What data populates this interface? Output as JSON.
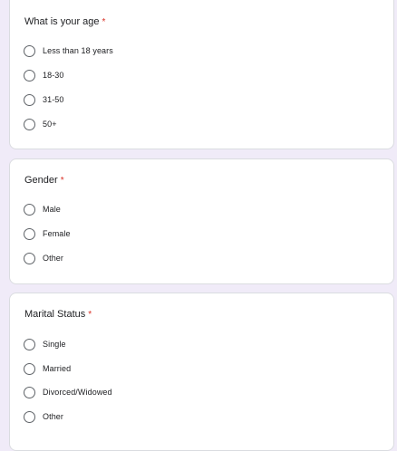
{
  "questions": [
    {
      "title": "What is your age",
      "required_mark": "*",
      "options": [
        "Less than 18 years",
        "18-30",
        "31-50",
        "50+"
      ]
    },
    {
      "title": "Gender",
      "required_mark": "*",
      "options": [
        "Male",
        "Female",
        "Other"
      ]
    },
    {
      "title": "Marital Status",
      "required_mark": "*",
      "options": [
        "Single",
        "Married",
        "Divorced/Widowed",
        "Other"
      ]
    }
  ],
  "colors": {
    "page_background": "#f0ebf8",
    "card_background": "#ffffff",
    "card_border": "#dadce0",
    "required": "#d93025",
    "radio_border": "#5f6368"
  }
}
